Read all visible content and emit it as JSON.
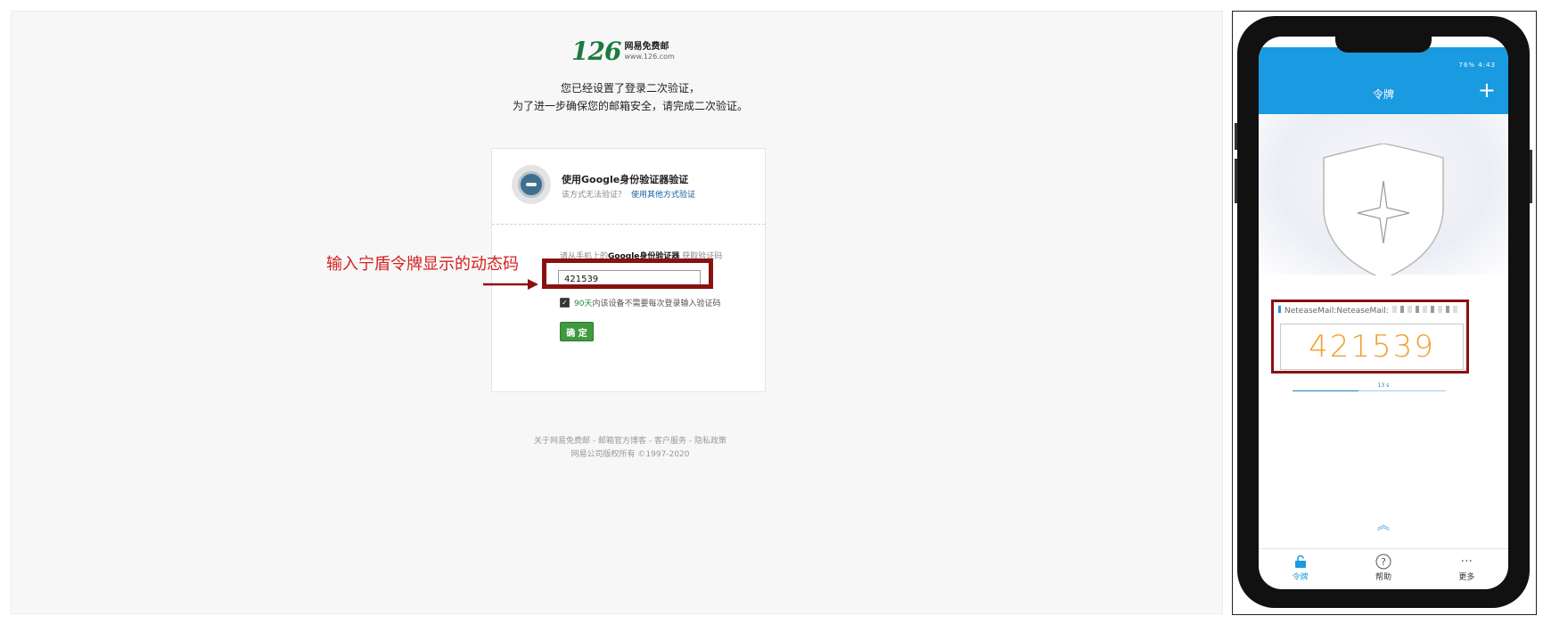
{
  "web": {
    "logo_num": "126",
    "logo_cn": "网易免费邮",
    "logo_url": "www.126.com",
    "notice_line1": "您已经设置了登录二次验证，",
    "notice_line2": "为了进一步确保您的邮箱安全，请完成二次验证。",
    "method_title": "使用Google身份验证器验证",
    "method_sub": "该方式无法验证？",
    "method_link": "使用其他方式验证",
    "prompt_before": "请从手机上的",
    "prompt_bold": "Google身份验证器",
    "prompt_after": " 获取验证码",
    "code_value": "421539",
    "remember_prefix": "90天",
    "remember_rest": "内该设备不需要每次登录输入验证码",
    "confirm_label": "确 定",
    "footer_line1": "关于网易免费邮 - 邮箱官方博客 - 客户服务 - 隐私政策",
    "footer_line2": "网易公司版权所有 ©1997-2020"
  },
  "annotation": {
    "text": "输入宁盾令牌显示的动态码",
    "color": "#d51f1f",
    "box_color": "#8b1010"
  },
  "phone": {
    "status": "76% 4:43",
    "app_title": "令牌",
    "add_icon": "plus-icon",
    "account_label": "NeteaseMail:NeteaseMail:",
    "otp_code": "421539",
    "timer_label": "13 s",
    "timer_fraction": 0.43,
    "nav": [
      {
        "label": "令牌",
        "icon": "lock-icon"
      },
      {
        "label": "帮助",
        "icon": "help-icon"
      },
      {
        "label": "更多",
        "icon": "more-icon"
      }
    ],
    "accent_color": "#1a9ae0",
    "code_color": "#f0a030"
  }
}
